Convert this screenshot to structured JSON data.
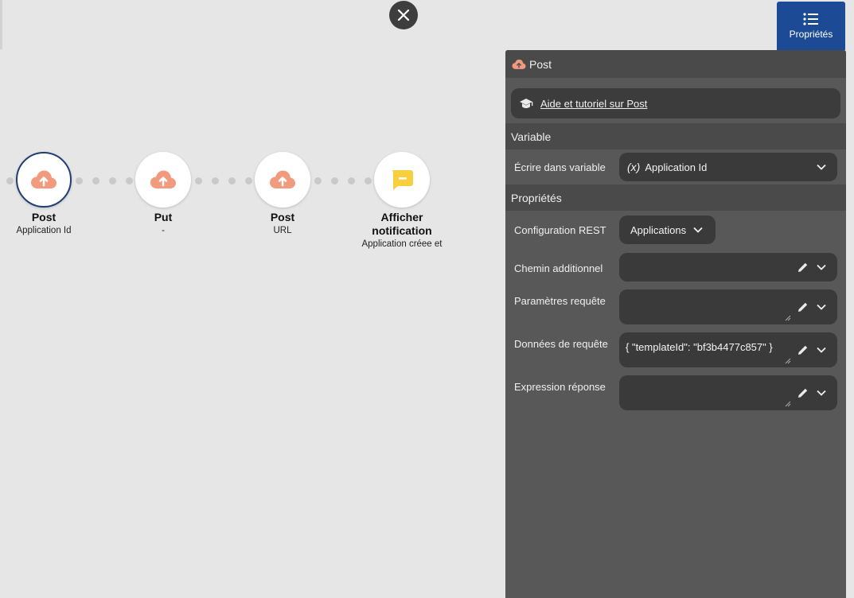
{
  "canvas": {
    "nodes": [
      {
        "title": "Post",
        "subtitle": "Application Id",
        "icon": "cloud-upload-icon",
        "selected": true
      },
      {
        "title": "Put",
        "subtitle": "-",
        "icon": "cloud-upload-icon",
        "selected": false
      },
      {
        "title": "Post",
        "subtitle": "URL",
        "icon": "cloud-upload-icon",
        "selected": false
      },
      {
        "title": "Afficher notification",
        "subtitle": "Application créee et",
        "icon": "notification-icon",
        "selected": false
      }
    ]
  },
  "properties_tab": {
    "label": "Propriétés"
  },
  "panel": {
    "title": "Post",
    "help_link": "Aide et tutoriel sur Post",
    "section_variable": "Variable",
    "write_variable_label": "Écrire dans variable",
    "variable_prefix": "(x)",
    "variable_value": "Application Id",
    "section_properties": "Propriétés",
    "rest_config_label": "Configuration REST",
    "rest_config_value": "Applications",
    "additional_path_label": "Chemin additionnel",
    "additional_path_value": "",
    "request_params_label": "Paramètres requête",
    "request_params_value": "",
    "request_data_label": "Données de requête",
    "request_data_value": "{ \"templateId\": \"bf3b4477c857\" }",
    "response_expr_label": "Expression réponse",
    "response_expr_value": ""
  },
  "colors": {
    "accent_blue": "#1c4a94",
    "node_border": "#1f3f73",
    "cloud_icon": "#f29a7e",
    "notification_icon": "#f9cf3d",
    "panel_bg": "#585858",
    "field_bg": "#3a3a3a"
  }
}
